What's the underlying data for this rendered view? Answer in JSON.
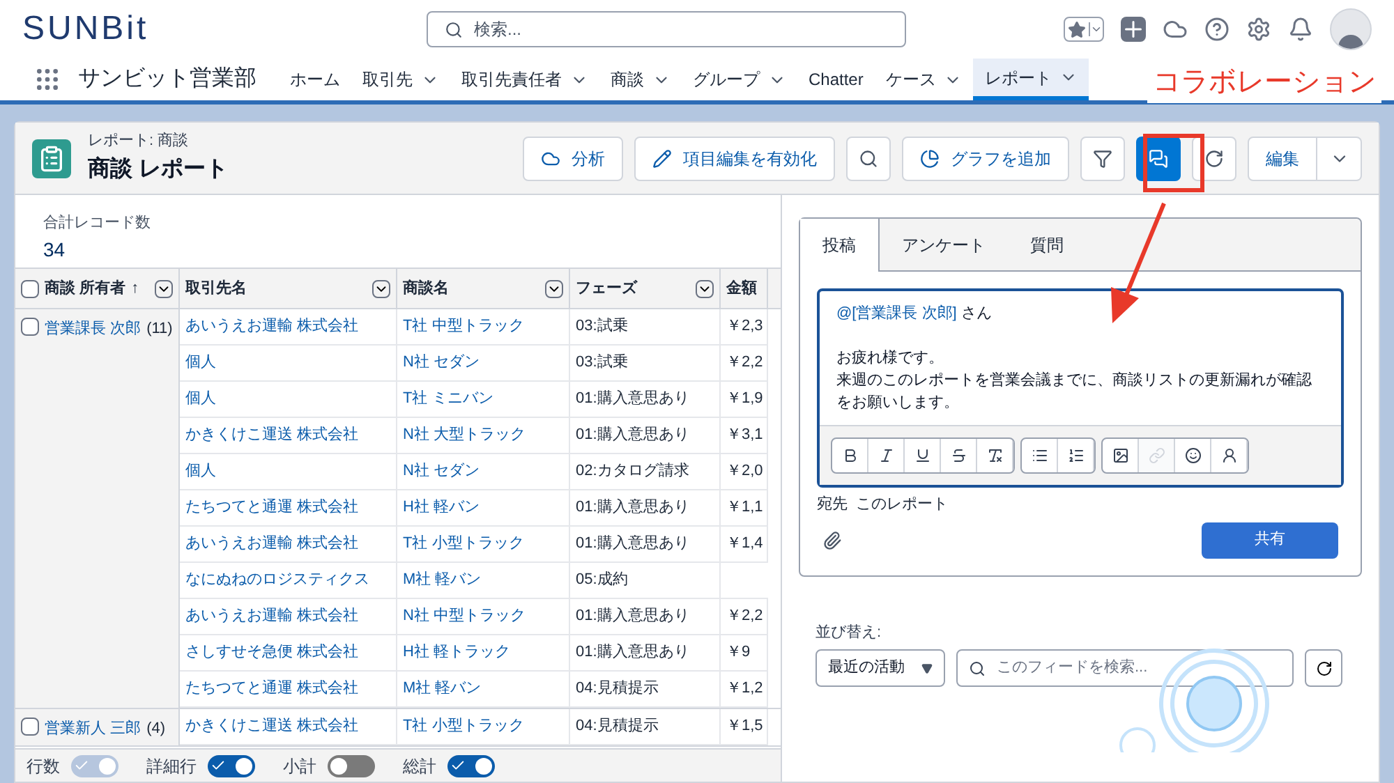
{
  "header": {
    "logo": "SUNBit",
    "search": {
      "placeholder": "検索..."
    }
  },
  "nav": {
    "app_name": "サンビット営業部",
    "items": [
      {
        "label": "ホーム",
        "dropdown": false,
        "selected": false
      },
      {
        "label": "取引先",
        "dropdown": true,
        "selected": false
      },
      {
        "label": "取引先責任者",
        "dropdown": true,
        "selected": false
      },
      {
        "label": "商談",
        "dropdown": true,
        "selected": false
      },
      {
        "label": "グループ",
        "dropdown": true,
        "selected": false
      },
      {
        "label": "Chatter",
        "dropdown": false,
        "selected": false
      },
      {
        "label": "ケース",
        "dropdown": true,
        "selected": false
      },
      {
        "label": "レポート",
        "dropdown": true,
        "selected": true
      }
    ]
  },
  "report_header": {
    "eyebrow": "レポート: 商談",
    "title": "商談 レポート",
    "buttons": [
      {
        "kind": "text",
        "label": "分析"
      },
      {
        "kind": "text",
        "label": "項目編集を有効化"
      },
      {
        "kind": "icon"
      },
      {
        "kind": "text",
        "label": "グラフを追加"
      },
      {
        "kind": "icon",
        "selected": false
      },
      {
        "kind": "icon",
        "selected": true
      },
      {
        "kind": "icon"
      },
      {
        "kind": "split",
        "label": "編集"
      }
    ]
  },
  "summary": {
    "label": "合計レコード数",
    "value": "34"
  },
  "table": {
    "all_checked": false,
    "columns": [
      {
        "label": "商談 所有者",
        "sort": "↑",
        "menu": true
      },
      {
        "label": "取引先名",
        "menu": true
      },
      {
        "label": "商談名",
        "menu": true
      },
      {
        "label": "フェーズ",
        "menu": true
      },
      {
        "label": "金額",
        "menu": false
      }
    ],
    "groups": [
      {
        "owner": "営業課長 次郎",
        "count": "(11)",
        "checked": false,
        "rows": [
          [
            "あいうえお運輸 株式会社",
            "T社 中型トラック",
            "03:試乗",
            "￥2,3"
          ],
          [
            "個人",
            "N社 セダン",
            "03:試乗",
            "￥2,2"
          ],
          [
            "個人",
            "T社 ミニバン",
            "01:購入意思あり",
            "￥1,9"
          ],
          [
            "かきくけこ運送 株式会社",
            "N社 大型トラック",
            "01:購入意思あり",
            "￥3,1"
          ],
          [
            "個人",
            "N社 セダン",
            "02:カタログ請求",
            "￥2,0"
          ],
          [
            "たちつてと通運 株式会社",
            "H社 軽バン",
            "01:購入意思あり",
            "￥1,1"
          ],
          [
            "あいうえお運輸 株式会社",
            "T社 小型トラック",
            "01:購入意思あり",
            "￥1,4"
          ],
          [
            "なにぬねのロジスティクス",
            "M社 軽バン",
            "05:成約"
          ],
          [
            "あいうえお運輸 株式会社",
            "N社 中型トラック",
            "01:購入意思あり",
            "￥2,2"
          ],
          [
            "さしすせそ急便 株式会社",
            "H社 軽トラック",
            "01:購入意思あり",
            "￥9"
          ],
          [
            "たちつてと通運 株式会社",
            "M社 軽バン",
            "04:見積提示",
            "￥1,2"
          ]
        ]
      },
      {
        "owner": "営業新人 三郎",
        "count": "(4)",
        "checked": false,
        "rows": [
          [
            "かきくけこ運送 株式会社",
            "T社 小型トラック",
            "04:見積提示",
            "￥1,5"
          ]
        ]
      }
    ]
  },
  "toggles": [
    {
      "label": "行数",
      "on": true,
      "disabled": true
    },
    {
      "label": "詳細行",
      "on": true,
      "disabled": false
    },
    {
      "label": "小計",
      "on": false,
      "disabled": false
    },
    {
      "label": "総計",
      "on": true,
      "disabled": false
    }
  ],
  "publisher": {
    "tabs": [
      {
        "label": "投稿",
        "selected": true
      },
      {
        "label": "アンケート",
        "selected": false
      },
      {
        "label": "質問",
        "selected": false
      }
    ],
    "mention": "@[営業課長 次郎]",
    "mention_suffix": " さん",
    "lines": [
      "お疲れ様です。",
      "来週のこのレポートを営業会議までに、商談リストの更新漏れが確認をお願いします。"
    ],
    "toolbar": [
      [
        {
          "disabled": false
        },
        {
          "disabled": false
        },
        {
          "disabled": false
        },
        {
          "disabled": false
        },
        {
          "disabled": false
        }
      ],
      [
        {
          "disabled": false
        },
        {
          "disabled": false
        }
      ],
      [
        {
          "disabled": false
        },
        {
          "disabled": true
        },
        {
          "disabled": false
        },
        {
          "disabled": false
        }
      ]
    ],
    "recipient": "宛先  このレポート",
    "share": "共有"
  },
  "feed": {
    "sort_label": "並び替え:",
    "sort_value": "最近の活動",
    "search_placeholder": "このフィードを検索..."
  },
  "annotation": {
    "label": "コラボレーション"
  }
}
